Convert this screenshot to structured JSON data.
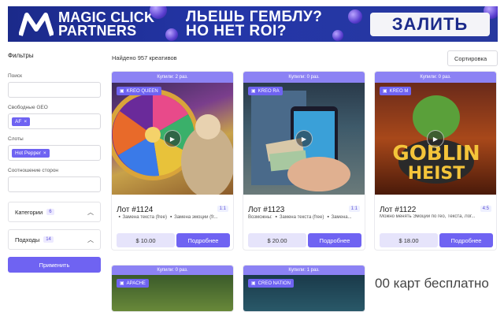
{
  "banner": {
    "brand_line1": "MAGIC CLICK",
    "brand_line2": "PARTNERS",
    "slogan_line1": "ЛЬЕШЬ ГЕМБЛУ?",
    "slogan_line2": "НО НЕТ ROI?",
    "cta": "ЗАЛИТЬ",
    "colors": {
      "background": "#2436a8",
      "cta_text": "#1b2a8a"
    }
  },
  "sidebar": {
    "title": "Фильтры",
    "search_label": "Поиск",
    "search_value": "",
    "geo_label": "Свободные GEO",
    "geo_tag": "AF",
    "slots_label": "Слоты",
    "slots_tag": "Hot Pepper",
    "ratio_label": "Соотношение сторон",
    "ratio_value": "",
    "categories_label": "Категории",
    "categories_count": "6",
    "subcategories_label": "Подходы",
    "subcategories_count": "14",
    "apply_label": "Применить"
  },
  "content": {
    "found_text": "Найдено 957 креативов",
    "sort_label": "Сортировка",
    "accent_color": "#6f63f2"
  },
  "cards": [
    {
      "bought": "Купили: 2 раз.",
      "badge": "KREO QUEEN",
      "title": "Лот #1124",
      "ratio": "1:1",
      "desc": "▪️Замена текста (free) ▪️Замена эмоции (fr...",
      "price": "$ 10.00",
      "more": "Подробнее"
    },
    {
      "bought": "Купили: 0 раз.",
      "badge": "KREO RA",
      "title": "Лот #1123",
      "ratio": "1:1",
      "desc": "Возможны: ▪️Замена текста (free) ▪️Замена...",
      "price": "$ 20.00",
      "more": "Подробнее"
    },
    {
      "bought": "Купили: 0 раз.",
      "badge": "KREO M",
      "title": "Лот #1122",
      "ratio": "4:5",
      "desc": "Можно менять Эмоции по гео, Текста, Лог...",
      "price": "$ 18.00",
      "more": "Подробнее"
    }
  ],
  "cards_row2": [
    {
      "bought": "Купили: 0 раз.",
      "badge": "APACHE"
    },
    {
      "bought": "Купили: 1 раз.",
      "badge": "CREO NATION"
    }
  ],
  "promo_text": "00 карт бесплатно"
}
